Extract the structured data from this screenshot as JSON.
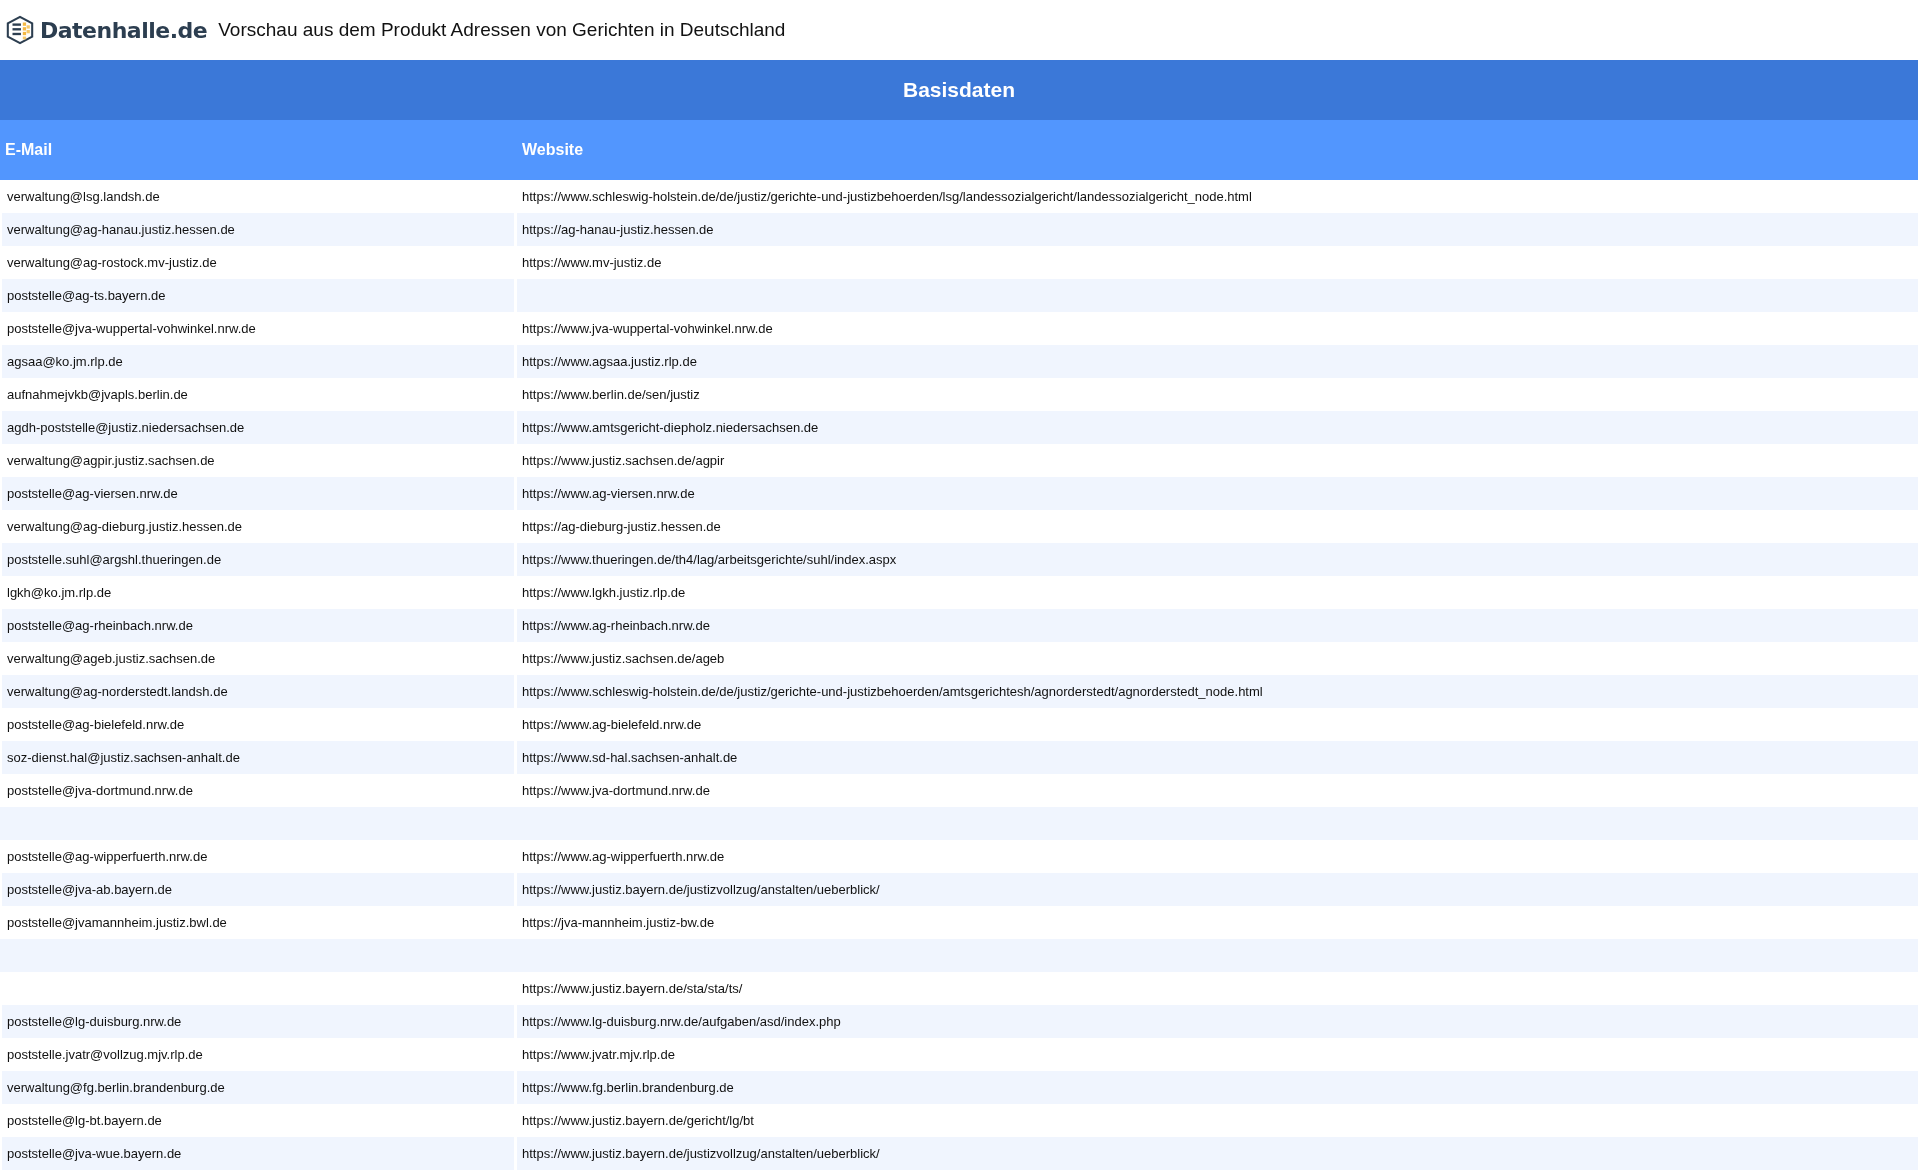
{
  "header": {
    "logo": "Datenhalle.de",
    "title": "Vorschau aus dem Produkt Adressen von Gerichten in Deutschland"
  },
  "table": {
    "group_title": "Basisdaten",
    "columns": [
      "E-Mail",
      "Website"
    ],
    "rows": [
      {
        "email": "verwaltung@lsg.landsh.de",
        "website": "https://www.schleswig-holstein.de/de/justiz/gerichte-und-justizbehoerden/lsg/landessozialgericht/landessozialgericht_node.html"
      },
      {
        "email": "verwaltung@ag-hanau.justiz.hessen.de",
        "website": "https://ag-hanau-justiz.hessen.de"
      },
      {
        "email": "verwaltung@ag-rostock.mv-justiz.de",
        "website": "https://www.mv-justiz.de"
      },
      {
        "email": "poststelle@ag-ts.bayern.de"
      },
      {
        "email": "poststelle@jva-wuppertal-vohwinkel.nrw.de",
        "website": "https://www.jva-wuppertal-vohwinkel.nrw.de"
      },
      {
        "email": "agsaa@ko.jm.rlp.de",
        "website": "https://www.agsaa.justiz.rlp.de"
      },
      {
        "email": "aufnahmejvkb@jvapls.berlin.de",
        "website": "https://www.berlin.de/sen/justiz"
      },
      {
        "email": "agdh-poststelle@justiz.niedersachsen.de",
        "website": "https://www.amtsgericht-diepholz.niedersachsen.de"
      },
      {
        "email": "verwaltung@agpir.justiz.sachsen.de",
        "website": "https://www.justiz.sachsen.de/agpir"
      },
      {
        "email": "poststelle@ag-viersen.nrw.de",
        "website": "https://www.ag-viersen.nrw.de"
      },
      {
        "email": "verwaltung@ag-dieburg.justiz.hessen.de",
        "website": "https://ag-dieburg-justiz.hessen.de"
      },
      {
        "email": "poststelle.suhl@argshl.thueringen.de",
        "website": "https://www.thueringen.de/th4/lag/arbeitsgerichte/suhl/index.aspx"
      },
      {
        "email": "lgkh@ko.jm.rlp.de",
        "website": "https://www.lgkh.justiz.rlp.de"
      },
      {
        "email": "poststelle@ag-rheinbach.nrw.de",
        "website": "https://www.ag-rheinbach.nrw.de"
      },
      {
        "email": "verwaltung@ageb.justiz.sachsen.de",
        "website": "https://www.justiz.sachsen.de/ageb"
      },
      {
        "email": "verwaltung@ag-norderstedt.landsh.de",
        "website": "https://www.schleswig-holstein.de/de/justiz/gerichte-und-justizbehoerden/amtsgerichtesh/agnorderstedt/agnorderstedt_node.html"
      },
      {
        "email": "poststelle@ag-bielefeld.nrw.de",
        "website": "https://www.ag-bielefeld.nrw.de"
      },
      {
        "email": "soz-dienst.hal@justiz.sachsen-anhalt.de",
        "website": "https://www.sd-hal.sachsen-anhalt.de"
      },
      {
        "email": "poststelle@jva-dortmund.nrw.de",
        "website": "https://www.jva-dortmund.nrw.de"
      },
      {},
      {
        "email": "poststelle@ag-wipperfuerth.nrw.de",
        "website": "https://www.ag-wipperfuerth.nrw.de"
      },
      {
        "email": "poststelle@jva-ab.bayern.de",
        "website": "https://www.justiz.bayern.de/justizvollzug/anstalten/ueberblick/"
      },
      {
        "email": "poststelle@jvamannheim.justiz.bwl.de",
        "website": "https://jva-mannheim.justiz-bw.de"
      },
      {},
      {
        "website": "https://www.justiz.bayern.de/sta/sta/ts/"
      },
      {
        "email": "poststelle@lg-duisburg.nrw.de",
        "website": "https://www.lg-duisburg.nrw.de/aufgaben/asd/index.php"
      },
      {
        "email": "poststelle.jvatr@vollzug.mjv.rlp.de",
        "website": "https://www.jvatr.mjv.rlp.de"
      },
      {
        "email": "verwaltung@fg.berlin.brandenburg.de",
        "website": "https://www.fg.berlin.brandenburg.de"
      },
      {
        "email": "poststelle@lg-bt.bayern.de",
        "website": "https://www.justiz.bayern.de/gericht/lg/bt"
      },
      {
        "email": "poststelle@jva-wue.bayern.de",
        "website": "https://www.justiz.bayern.de/justizvollzug/anstalten/ueberblick/"
      }
    ]
  }
}
